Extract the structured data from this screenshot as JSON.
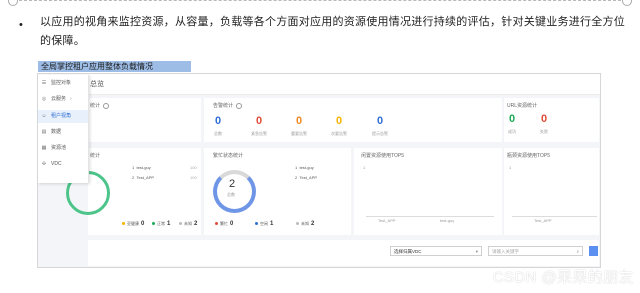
{
  "doc": {
    "bullet": "•",
    "paragraph": "以应用的视角来监控资源，从容量，负载等各个方面对应用的资源使用情况进行持续的评估，针对关键业务进行全方位的保障。",
    "caption": "全局掌控租户应用整体负载情况",
    "watermark": "CSDN @果果的朋友"
  },
  "screenshot": {
    "header_title": "总览",
    "menu": [
      {
        "icon": "list-icon",
        "glyph": "☰",
        "label": "监控对象",
        "active": false
      },
      {
        "icon": "cloud-icon",
        "glyph": "◎",
        "label": "云服务",
        "active": false
      },
      {
        "icon": "user-icon",
        "glyph": "☺",
        "label": "租户视角",
        "active": true
      },
      {
        "icon": "db-icon",
        "glyph": "▤",
        "label": "数据",
        "active": false
      },
      {
        "icon": "resource-icon",
        "glyph": "▦",
        "label": "资源池",
        "active": false
      },
      {
        "icon": "vdc-icon",
        "glyph": "✣",
        "label": "VDC",
        "active": false
      }
    ],
    "panels": {
      "app_stats": {
        "title": "统计"
      },
      "alarm_stats": {
        "title": "告警统计",
        "items": [
          {
            "value": "0",
            "label": "总数",
            "color": "#2f6fd6"
          },
          {
            "value": "0",
            "label": "紧急告警",
            "color": "#e14b3b"
          },
          {
            "value": "0",
            "label": "重要告警",
            "color": "#f08a24"
          },
          {
            "value": "0",
            "label": "次要告警",
            "color": "#f5b400"
          },
          {
            "value": "0",
            "label": "提示告警",
            "color": "#2f6fd6"
          }
        ]
      },
      "url_stats": {
        "title": "URL资源统计",
        "items": [
          {
            "value": "0",
            "label": "成功",
            "color": "#1aaa55"
          },
          {
            "value": "0",
            "label": "失败",
            "color": "#e14b3b"
          }
        ]
      },
      "health_stats": {
        "title": "统计",
        "list": [
          {
            "rank": "1",
            "name": "test-guy",
            "value": "100"
          },
          {
            "rank": "2",
            "name": "Test_APP",
            "value": "100"
          }
        ],
        "legend": [
          {
            "label": "亚健康",
            "value": "0",
            "color": "#f5b400"
          },
          {
            "label": "正常",
            "value": "1",
            "color": "#1aaa55"
          },
          {
            "label": "未知",
            "value": "2",
            "color": "#bbbbbb"
          }
        ]
      },
      "busy_stats": {
        "title": "繁忙状态统计",
        "donut_value": "2",
        "donut_label": "总数",
        "list": [
          {
            "rank": "1",
            "name": "test-guy",
            "value": ""
          },
          {
            "rank": "2",
            "name": "Test_APP",
            "value": ""
          }
        ],
        "legend": [
          {
            "label": "繁忙",
            "value": "0",
            "color": "#e14b3b"
          },
          {
            "label": "空闲",
            "value": "1",
            "color": "#2f6fd6"
          },
          {
            "label": "未知",
            "value": "2",
            "color": "#bbbbbb"
          }
        ]
      },
      "cpu_top5": {
        "title": "闲置资源使用TOP5",
        "ytick": "1",
        "xticks": [
          "Test_APP",
          "test-guy"
        ]
      },
      "mem_top5": {
        "title": "瓶颈资源使用TOP5",
        "ytick": "1",
        "xticks": [
          "Test_APP"
        ]
      }
    },
    "filters": {
      "vdc_select": "选择归属VDC",
      "search_placeholder": "请输入关键字"
    }
  }
}
